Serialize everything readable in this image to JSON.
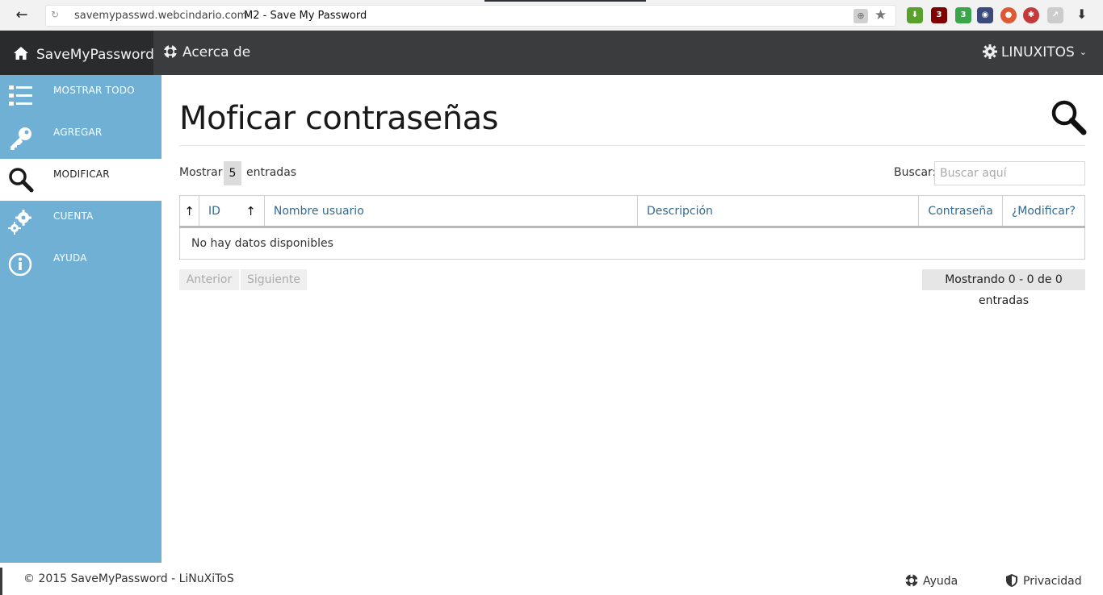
{
  "browser": {
    "url": "savemypasswd.webcindario.com",
    "tab_title": "M2 - Save My Password",
    "extensions": [
      "download-helper-icon",
      "ublock-icon",
      "shield-check-icon",
      "eye-icon",
      "duckduckgo-icon",
      "bug-icon",
      "puzzle-icon"
    ],
    "ublock_badge": "3",
    "shield_badge": "3"
  },
  "navbar": {
    "brand": "SaveMyPassword",
    "about": "Acerca de",
    "user": "LINUXITOS",
    "caret": "⌄"
  },
  "sidebar": {
    "items": [
      {
        "label": "MOSTRAR TODO",
        "icon": "list-icon"
      },
      {
        "label": "AGREGAR",
        "icon": "key-icon"
      },
      {
        "label": "MODIFICAR",
        "icon": "search-icon",
        "active": true
      },
      {
        "label": "CUENTA",
        "icon": "gears-icon"
      },
      {
        "label": "AYUDA",
        "icon": "info-icon"
      }
    ]
  },
  "main": {
    "title": "Moficar contraseñas",
    "length": {
      "prefix": "Mostrar",
      "value": "5",
      "suffix": "entradas"
    },
    "search": {
      "label": "Buscar:",
      "placeholder": "Buscar aquí"
    },
    "table": {
      "columns": [
        "ID",
        "Nombre usuario",
        "Descripción",
        "Contraseña",
        "¿Modificar?"
      ],
      "empty": "No hay datos disponibles"
    },
    "pagination": {
      "prev": "Anterior",
      "next": "Siguiente"
    },
    "info": "Mostrando 0 - 0 de 0 entradas"
  },
  "footer": {
    "copyright": "© 2015 SaveMyPassword - LiNuXiToS",
    "help": "Ayuda",
    "privacy": "Privacidad"
  },
  "colors": {
    "sidebar": "#70b0d5",
    "navbar": "#3b3c3e",
    "header_link": "#336a91"
  }
}
